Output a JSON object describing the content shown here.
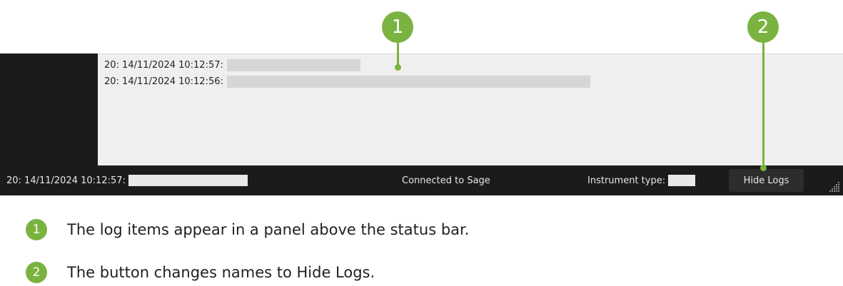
{
  "callouts": [
    {
      "number": "1"
    },
    {
      "number": "2"
    }
  ],
  "log_panel": {
    "lines": [
      {
        "prefix": "20: 14/11/2024 10:12:57:"
      },
      {
        "prefix": "20: 14/11/2024 10:12:56:"
      }
    ]
  },
  "status_bar": {
    "last_log": "20: 14/11/2024 10:12:57:",
    "connection": "Connected to Sage",
    "instrument_label": "Instrument type:",
    "hide_logs_button": "Hide Logs"
  },
  "notes": [
    {
      "number": "1",
      "text": "The log items appear in a panel above the status bar."
    },
    {
      "number": "2",
      "text": "The button changes names to Hide Logs."
    }
  ],
  "colors": {
    "accent": "#7ab340",
    "status_bar_bg": "#1b1b1b",
    "log_panel_bg": "#efefef",
    "redaction": "#d6d6d6"
  }
}
